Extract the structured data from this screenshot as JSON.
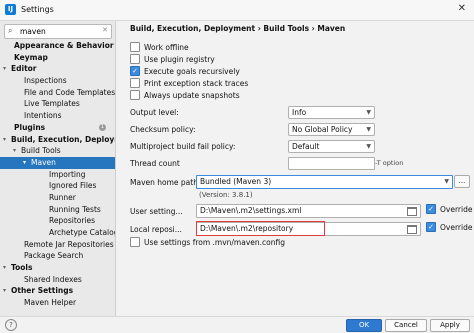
{
  "window": {
    "title": "Settings"
  },
  "search": {
    "value": "maven"
  },
  "tree": [
    {
      "label": "Appearance & Behavior",
      "level": 0,
      "bold": true,
      "arrow": ""
    },
    {
      "label": "Keymap",
      "level": 0,
      "bold": true,
      "arrow": ""
    },
    {
      "label": "Editor",
      "level": 0,
      "bold": true,
      "arrow": "▾"
    },
    {
      "label": "Inspections",
      "level": 1
    },
    {
      "label": "File and Code Templates",
      "level": 1
    },
    {
      "label": "Live Templates",
      "level": 1
    },
    {
      "label": "Intentions",
      "level": 1
    },
    {
      "label": "Plugins",
      "level": 0,
      "bold": true,
      "badge": "1"
    },
    {
      "label": "Build, Execution, Deployment",
      "level": 0,
      "bold": true,
      "arrow": "▾"
    },
    {
      "label": "Build Tools",
      "level": 1,
      "arrow": "▾"
    },
    {
      "label": "Maven",
      "level": 2,
      "arrow": "▾",
      "selected": true
    },
    {
      "label": "Importing",
      "level": 3
    },
    {
      "label": "Ignored Files",
      "level": 3
    },
    {
      "label": "Runner",
      "level": 3
    },
    {
      "label": "Running Tests",
      "level": 3
    },
    {
      "label": "Repositories",
      "level": 3
    },
    {
      "label": "Archetype Catalog",
      "level": 3
    },
    {
      "label": "Remote Jar Repositories",
      "level": 1
    },
    {
      "label": "Package Search",
      "level": 1
    },
    {
      "label": "Tools",
      "level": 0,
      "bold": true,
      "arrow": "▾"
    },
    {
      "label": "Shared Indexes",
      "level": 1
    },
    {
      "label": "Other Settings",
      "level": 0,
      "bold": true,
      "arrow": "▾"
    },
    {
      "label": "Maven Helper",
      "level": 1
    }
  ],
  "breadcrumb": "Build, Execution, Deployment › Build Tools › Maven",
  "checks": [
    {
      "label": "Work offline",
      "checked": false
    },
    {
      "label": "Use plugin registry",
      "checked": false
    },
    {
      "label": "Execute goals recursively",
      "checked": true
    },
    {
      "label": "Print exception stack traces",
      "checked": false
    },
    {
      "label": "Always update snapshots",
      "checked": false
    }
  ],
  "output_level": {
    "label": "Output level:",
    "value": "Info"
  },
  "checksum": {
    "label": "Checksum policy:",
    "value": "No Global Policy"
  },
  "fail_policy": {
    "label": "Multiproject build fail policy:",
    "value": "Default"
  },
  "thread_count": {
    "label": "Thread count",
    "value": "",
    "hint": "-T option"
  },
  "home": {
    "label": "Maven home path:",
    "value": "Bundled (Maven 3)",
    "version": "(Version: 3.8.1)",
    "more": "..."
  },
  "user_settings": {
    "label": "User setting...",
    "value": "D:\\Maven\\.m2\\settings.xml",
    "override": "Override",
    "override_checked": true
  },
  "local_repo": {
    "label": "Local reposi...",
    "value": "D:\\Maven\\.m2\\repository",
    "override": "Override",
    "override_checked": true
  },
  "use_settings": {
    "label": "Use settings from .mvn/maven.config",
    "checked": false
  },
  "buttons": {
    "ok": "OK",
    "cancel": "Cancel",
    "apply": "Apply",
    "help": "?"
  },
  "colors": {
    "accent": "#2675bf",
    "highlight": "#e03c3c"
  }
}
